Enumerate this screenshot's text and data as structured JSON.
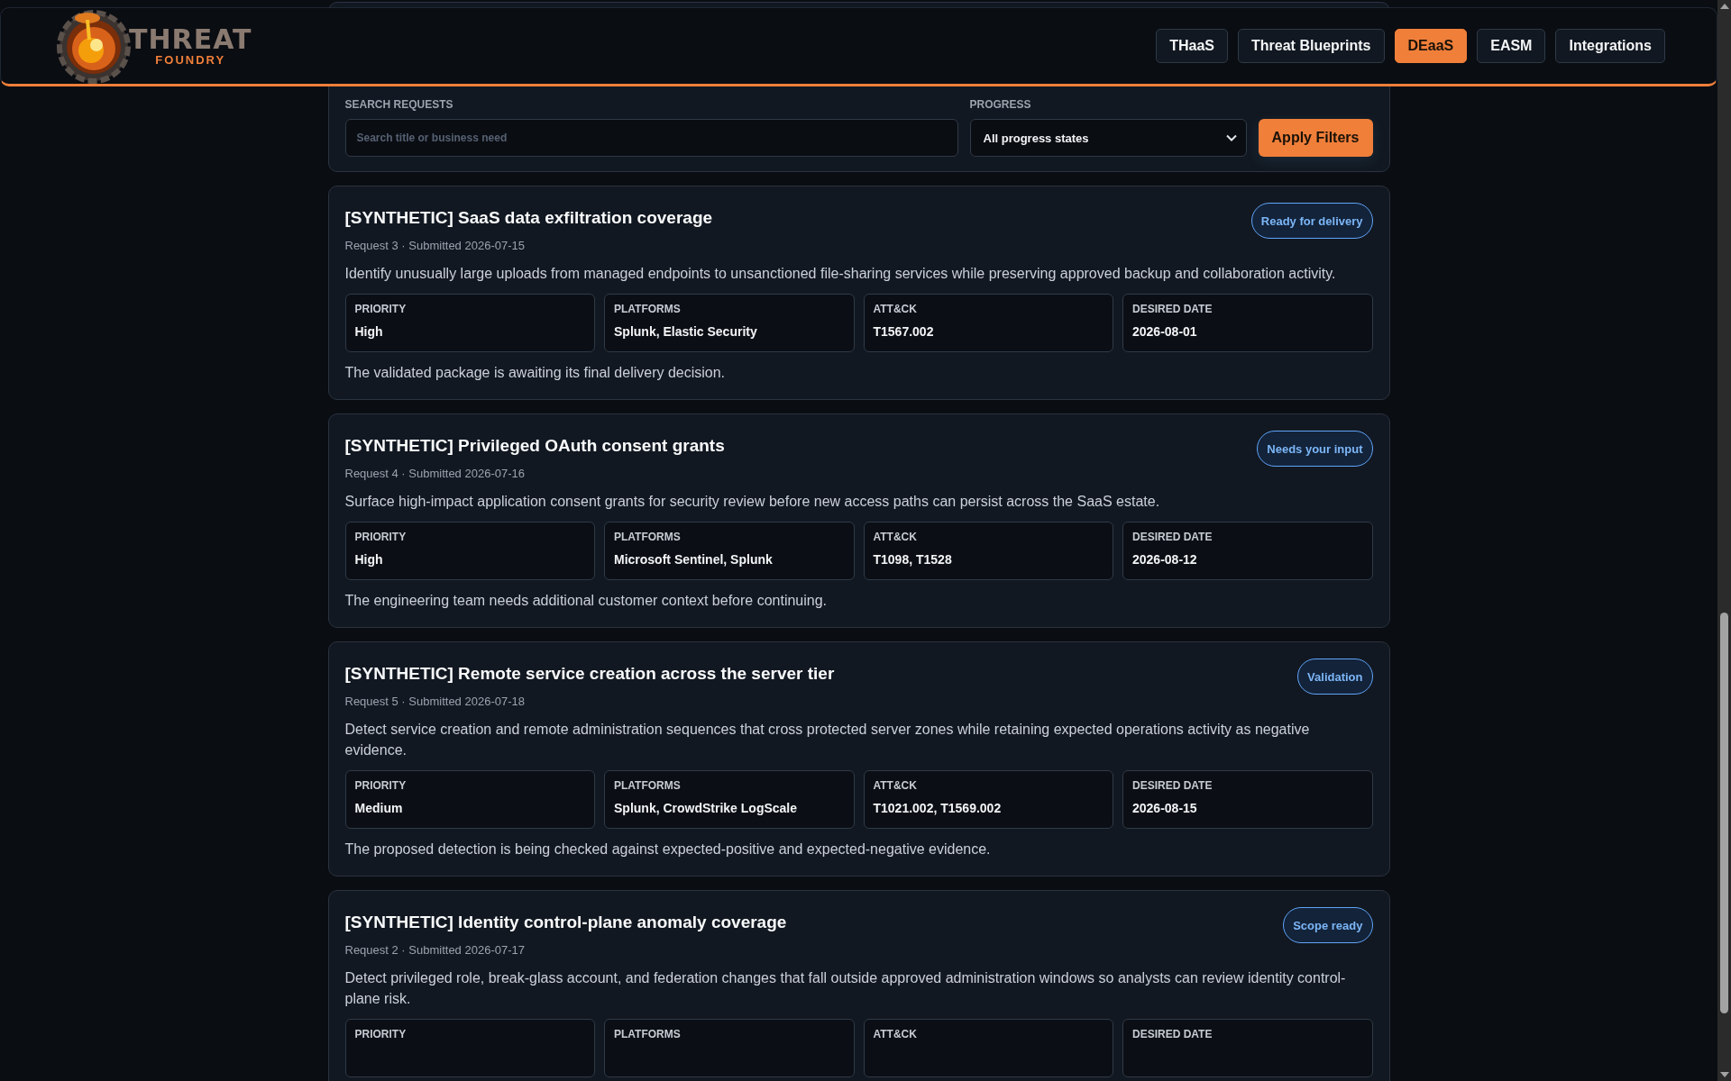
{
  "header": {
    "logo": {
      "line_1": "THREAT",
      "line_2": "FOUNDRY"
    },
    "nav": [
      {
        "label": "THaaS",
        "selected": false
      },
      {
        "label": "Threat Blueprints",
        "selected": false
      },
      {
        "label": "DEaaS",
        "selected": true
      },
      {
        "label": "EASM",
        "selected": false
      },
      {
        "label": "Integrations",
        "selected": false
      }
    ]
  },
  "filters": {
    "search": {
      "label": "SEARCH REQUESTS",
      "placeholder": "Search title or business need"
    },
    "progress": {
      "label": "PROGRESS",
      "value": "All progress states"
    },
    "apply_button": "Apply Filters"
  },
  "requests": [
    {
      "title": "[SYNTHETIC] SaaS data exfiltration coverage",
      "meta": "Request 3 · Submitted 2026-07-15",
      "status": "Ready for delivery",
      "description": "Identify unusually large uploads from managed endpoints to unsanctioned file-sharing services while preserving approved backup and collaboration activity.",
      "fields": [
        {
          "label": "PRIORITY",
          "value": "High"
        },
        {
          "label": "PLATFORMS",
          "value": "Splunk, Elastic Security"
        },
        {
          "label": "ATT&CK",
          "value": "T1567.002"
        },
        {
          "label": "DESIRED DATE",
          "value": "2026-08-01"
        }
      ],
      "note": "The validated package is awaiting its final delivery decision."
    },
    {
      "title": "[SYNTHETIC] Privileged OAuth consent grants",
      "meta": "Request 4 · Submitted 2026-07-16",
      "status": "Needs your input",
      "description": "Surface high-impact application consent grants for security review before new access paths can persist across the SaaS estate.",
      "fields": [
        {
          "label": "PRIORITY",
          "value": "High"
        },
        {
          "label": "PLATFORMS",
          "value": "Microsoft Sentinel, Splunk"
        },
        {
          "label": "ATT&CK",
          "value": "T1098, T1528"
        },
        {
          "label": "DESIRED DATE",
          "value": "2026-08-12"
        }
      ],
      "note": "The engineering team needs additional customer context before continuing."
    },
    {
      "title": "[SYNTHETIC] Remote service creation across the server tier",
      "meta": "Request 5 · Submitted 2026-07-18",
      "status": "Validation",
      "description": "Detect service creation and remote administration sequences that cross protected server zones while retaining expected operations activity as negative evidence.",
      "fields": [
        {
          "label": "PRIORITY",
          "value": "Medium"
        },
        {
          "label": "PLATFORMS",
          "value": "Splunk, CrowdStrike LogScale"
        },
        {
          "label": "ATT&CK",
          "value": "T1021.002, T1569.002"
        },
        {
          "label": "DESIRED DATE",
          "value": "2026-08-15"
        }
      ],
      "note": "The proposed detection is being checked against expected-positive and expected-negative evidence."
    },
    {
      "title": "[SYNTHETIC] Identity control-plane anomaly coverage",
      "meta": "Request 2 · Submitted 2026-07-17",
      "status": "Scope ready",
      "description": "Detect privileged role, break-glass account, and federation changes that fall outside approved administration windows so analysts can review identity control-plane risk.",
      "fields": [
        {
          "label": "PRIORITY"
        },
        {
          "label": "PLATFORMS"
        },
        {
          "label": "ATT&CK"
        },
        {
          "label": "DESIRED DATE"
        }
      ]
    }
  ]
}
